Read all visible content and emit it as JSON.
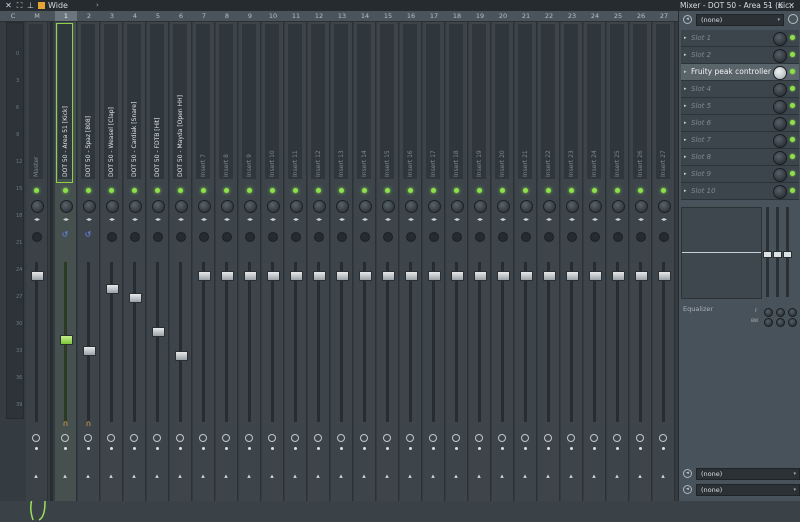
{
  "toolbar": {
    "view_mode": "Wide",
    "icons": [
      "mixer-icon",
      "link-icon",
      "upload-icon",
      "arrow-icon",
      "folder-icon"
    ]
  },
  "window": {
    "title": "Mixer - DOT 50 - Area 51 (Kic..",
    "controls": [
      "minimize",
      "maximize",
      "close"
    ]
  },
  "header": {
    "columns": [
      "C",
      "M",
      "1",
      "2",
      "3",
      "4",
      "5",
      "6",
      "7",
      "8",
      "9",
      "10",
      "11",
      "12",
      "13",
      "14",
      "15",
      "16",
      "17",
      "18",
      "19",
      "20",
      "21",
      "22",
      "23",
      "24",
      "25",
      "26",
      "27"
    ],
    "selected": "1"
  },
  "master_scale": [
    "0",
    "3",
    "6",
    "9",
    "12",
    "15",
    "18",
    "21",
    "24",
    "27",
    "30",
    "33",
    "36",
    "39"
  ],
  "tracks": [
    {
      "num": "M",
      "name": "Master",
      "dim": true
    },
    {
      "num": "1",
      "name": "DOT 50 - Area 51 [Kick]",
      "dim": false,
      "selected": true,
      "level": 0.52
    },
    {
      "num": "2",
      "name": "DOT 50 - Spaz [808]",
      "dim": false,
      "level": 0.45
    },
    {
      "num": "3",
      "name": "DOT 50 - Weasel [Clap]",
      "dim": false,
      "level": 0.84
    },
    {
      "num": "4",
      "name": "DOT 50 - Cardiak [Snare]",
      "dim": false,
      "level": 0.78
    },
    {
      "num": "5",
      "name": "DOT 50 - FDTB [Hit]",
      "dim": false,
      "level": 0.57
    },
    {
      "num": "6",
      "name": "DOT 50 - Mayda [Open HH]",
      "dim": false,
      "level": 0.42
    },
    {
      "num": "7",
      "name": "Insert 7",
      "dim": true
    },
    {
      "num": "8",
      "name": "Insert 8",
      "dim": true
    },
    {
      "num": "9",
      "name": "Insert 9",
      "dim": true
    },
    {
      "num": "10",
      "name": "Insert 10",
      "dim": true
    },
    {
      "num": "11",
      "name": "Insert 11",
      "dim": true
    },
    {
      "num": "12",
      "name": "Insert 12",
      "dim": true
    },
    {
      "num": "13",
      "name": "Insert 13",
      "dim": true
    },
    {
      "num": "14",
      "name": "Insert 14",
      "dim": true
    },
    {
      "num": "15",
      "name": "Insert 15",
      "dim": true
    },
    {
      "num": "16",
      "name": "Insert 16",
      "dim": true
    },
    {
      "num": "17",
      "name": "Insert 17",
      "dim": true
    },
    {
      "num": "18",
      "name": "Insert 18",
      "dim": true
    },
    {
      "num": "19",
      "name": "Insert 19",
      "dim": true
    },
    {
      "num": "20",
      "name": "Insert 20",
      "dim": true
    },
    {
      "num": "21",
      "name": "Insert 21",
      "dim": true
    },
    {
      "num": "22",
      "name": "Insert 22",
      "dim": true
    },
    {
      "num": "23",
      "name": "Insert 23",
      "dim": true
    },
    {
      "num": "24",
      "name": "Insert 24",
      "dim": true
    },
    {
      "num": "25",
      "name": "Insert 25",
      "dim": true
    },
    {
      "num": "26",
      "name": "Insert 26",
      "dim": true
    },
    {
      "num": "27",
      "name": "Insert 27",
      "dim": true
    }
  ],
  "panel": {
    "input_select": "(none)",
    "slots": [
      "Slot 1",
      "Slot 2",
      "Fruity peak controller",
      "Slot 4",
      "Slot 5",
      "Slot 6",
      "Slot 7",
      "Slot 8",
      "Slot 9",
      "Slot 10"
    ],
    "active_slot": "Fruity peak controller",
    "equalizer_label": "Equalizer",
    "eq_bands": [
      "F",
      "BW"
    ],
    "output_select_1": "(none)",
    "output_select_2": "(none)"
  },
  "colors": {
    "accent": "#8ee04a",
    "background": "#343b41",
    "panel": "#48525a"
  }
}
